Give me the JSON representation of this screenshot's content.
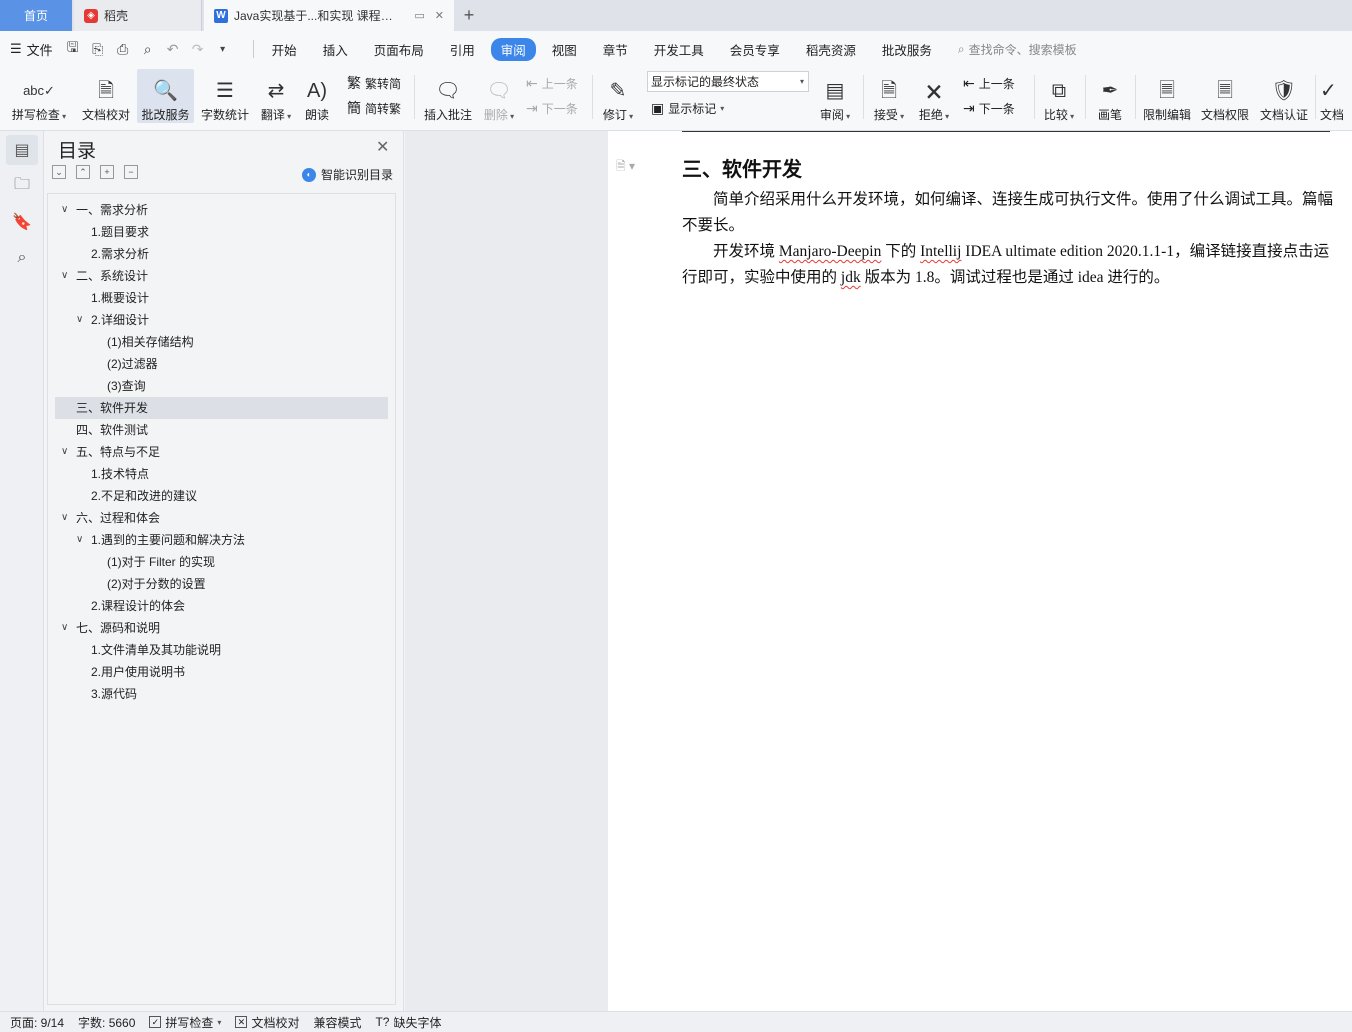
{
  "tabs": {
    "home": "首页",
    "daoke": "稻壳",
    "doc": "Java实现基于...和实现 课程论文",
    "add": "+"
  },
  "menubar": {
    "file": "文件",
    "items": [
      "开始",
      "插入",
      "页面布局",
      "引用",
      "审阅",
      "视图",
      "章节",
      "开发工具",
      "会员专享",
      "稻壳资源",
      "批改服务"
    ],
    "active": "审阅",
    "search": "查找命令、搜索模板"
  },
  "ribbon": {
    "spell": "拼写检查",
    "doc_check": "文档校对",
    "correct_service": "批改服务",
    "word_count": "字数统计",
    "translate": "翻译",
    "read_aloud": "朗读",
    "trad_to_simp": "繁转简",
    "simp_to_trad": "简转繁",
    "insert_comment": "插入批注",
    "delete": "删除",
    "prev_comment": "上一条",
    "next_comment": "下一条",
    "revise": "修订",
    "markup_state": "显示标记的最终状态",
    "show_markup": "显示标记",
    "review": "审阅",
    "accept": "接受",
    "reject": "拒绝",
    "prev_change": "上一条",
    "next_change": "下一条",
    "compare": "比较",
    "pen": "画笔",
    "restrict_edit": "限制编辑",
    "doc_permission": "文档权限",
    "doc_certify": "文档认证",
    "doc_more": "文档"
  },
  "toc": {
    "title": "目录",
    "smart": "智能识别目录",
    "items": [
      {
        "text": "一、需求分析",
        "level": 1,
        "expand": "open"
      },
      {
        "text": "1.题目要求",
        "level": 2,
        "expand": ""
      },
      {
        "text": "2.需求分析",
        "level": 2,
        "expand": ""
      },
      {
        "text": "二、系统设计",
        "level": 1,
        "expand": "open"
      },
      {
        "text": "1.概要设计",
        "level": 2,
        "expand": ""
      },
      {
        "text": "2.详细设计",
        "level": 2,
        "expand": "open"
      },
      {
        "text": "(1)相关存储结构",
        "level": 3,
        "expand": ""
      },
      {
        "text": "(2)过滤器",
        "level": 3,
        "expand": ""
      },
      {
        "text": "(3)查询",
        "level": 3,
        "expand": ""
      },
      {
        "text": "三、软件开发",
        "level": 1,
        "expand": "",
        "selected": true
      },
      {
        "text": "四、软件测试",
        "level": 1,
        "expand": ""
      },
      {
        "text": "五、特点与不足",
        "level": 1,
        "expand": "open"
      },
      {
        "text": "1.技术特点",
        "level": 2,
        "expand": ""
      },
      {
        "text": "2.不足和改进的建议",
        "level": 2,
        "expand": ""
      },
      {
        "text": "六、过程和体会",
        "level": 1,
        "expand": "open"
      },
      {
        "text": "1.遇到的主要问题和解决方法",
        "level": 2,
        "expand": "open"
      },
      {
        "text": "(1)对于 Filter 的实现",
        "level": 3,
        "expand": ""
      },
      {
        "text": "(2)对于分数的设置",
        "level": 3,
        "expand": ""
      },
      {
        "text": "2.课程设计的体会",
        "level": 2,
        "expand": ""
      },
      {
        "text": "七、源码和说明",
        "level": 1,
        "expand": "open"
      },
      {
        "text": "1.文件清单及其功能说明",
        "level": 2,
        "expand": ""
      },
      {
        "text": "2.用户使用说明书",
        "level": 2,
        "expand": ""
      },
      {
        "text": "3.源代码",
        "level": 2,
        "expand": ""
      }
    ]
  },
  "document": {
    "heading": "三、软件开发",
    "p1": "简单介绍采用什么开发环境，如何编译、连接生成可执行文件。使用了什么调试工具。篇幅不要长。",
    "p2_a": "开发环境 ",
    "p2_b": "Manjaro-Deepin",
    "p2_c": " 下的 ",
    "p2_d": "Intellij",
    "p2_e": " IDEA ultimate edition 2020.1.1-1，编译链接直接点击运行即可，实验中使用的 ",
    "p2_f": "jdk",
    "p2_g": " 版本为 1.8。调试过程也是通过 idea 进行的。"
  },
  "statusbar": {
    "page": "页面: 9/14",
    "words": "字数: 5660",
    "spell": "拼写检查",
    "doc_check": "文档校对",
    "compat": "兼容模式",
    "missing_font": "缺失字体"
  },
  "colors": {
    "accent": "#3b86e8",
    "home_tab": "#5a93e6",
    "spell_underline": "#e53935"
  }
}
